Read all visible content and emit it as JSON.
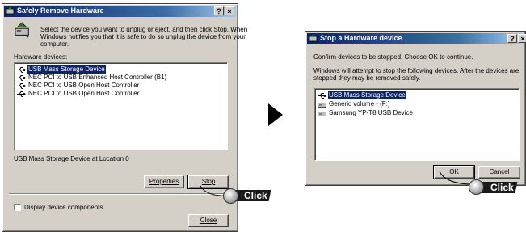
{
  "safely_remove": {
    "title": "Safely Remove Hardware",
    "help_button": "?",
    "close_button": "×",
    "instructions": [
      "Select the device you want to unplug or eject, and then click Stop. When",
      "Windows notifies you that it is safe to do so unplug the device from your",
      "computer."
    ],
    "hardware_devices_label": "Hardware devices:",
    "devices": [
      "USB Mass Storage Device",
      "NEC PCI to USB Enhanced Host Controller (B1)",
      "NEC PCI to USB Open Host Controller",
      "NEC PCI to USB Open Host Controller"
    ],
    "selected_index": 0,
    "status_text": "USB Mass Storage Device at Location 0",
    "properties_button": "Properties",
    "stop_button": "Stop",
    "display_components_label": "Display device components",
    "display_components_checked": false,
    "close_btn": "Close"
  },
  "stop_device": {
    "title": "Stop a Hardware device",
    "help_button": "?",
    "close_button": "×",
    "confirm_text": "Confirm devices to be stopped, Choose OK to continue.",
    "attempt_text": [
      "Windows will attempt to stop the following devices. After the devices are",
      "stopped they may be removed safely."
    ],
    "devices": [
      "USB Mass Storage Device",
      "Generic volume - (F:)",
      "Samsung YP-T8 USB Device"
    ],
    "selected_index": 0,
    "ok_button": "OK",
    "cancel_button": "Cancel"
  },
  "annotations": {
    "click_label_1": "Click",
    "click_label_2": "Click"
  },
  "icons": {
    "titlebar_icon": "hardware-remove-icon",
    "header_icon": "eject-hardware-icon",
    "usb_icon": "usb-plug-icon",
    "drive_icon": "disk-drive-icon",
    "arrow": "right-arrow-icon"
  }
}
